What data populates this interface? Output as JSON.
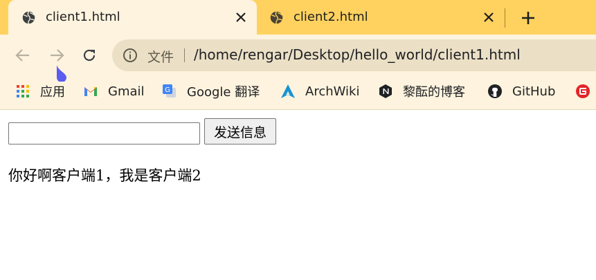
{
  "tabs": [
    {
      "title": "client1.html",
      "active": true,
      "icon": "globe-icon"
    },
    {
      "title": "client2.html",
      "active": false,
      "icon": "globe-icon"
    }
  ],
  "toolbar": {
    "back_icon": "arrow-left-icon",
    "forward_icon": "arrow-right-icon",
    "reload_icon": "reload-icon"
  },
  "omnibox": {
    "security_chip": "文件",
    "url": "/home/rengar/Desktop/hello_world/client1.html"
  },
  "bookmarks": [
    {
      "label": "应用",
      "icon": "apps-grid-icon"
    },
    {
      "label": "Gmail",
      "icon": "gmail-icon"
    },
    {
      "label": "Google 翻译",
      "icon": "google-translate-icon"
    },
    {
      "label": "ArchWiki",
      "icon": "archlinux-icon"
    },
    {
      "label": "黎酝的博客",
      "icon": "n-logo-icon"
    },
    {
      "label": "GitHub",
      "icon": "github-icon"
    }
  ],
  "page": {
    "input_value": "",
    "send_button_label": "发送信息",
    "message": "你好啊客户端1，我是客户端2"
  },
  "colors": {
    "tabstrip": "#ffd260",
    "toolbar": "#fdf3de",
    "omnibox": "#ebe0c6"
  }
}
